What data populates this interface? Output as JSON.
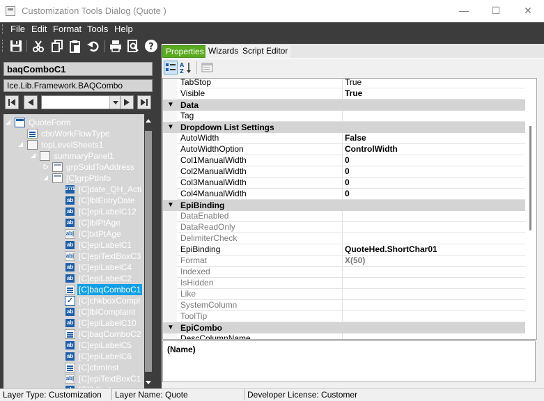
{
  "window": {
    "title": "Customization Tools Dialog  (Quote )",
    "minimize_glyph": "—",
    "maximize_glyph": "☐",
    "close_glyph": "✕"
  },
  "menu": {
    "items": [
      "File",
      "Edit",
      "Format",
      "Tools",
      "Help"
    ]
  },
  "toolbar": {
    "icons": [
      "save-icon",
      "cut-icon",
      "copy-icon",
      "paste-icon",
      "undo-icon",
      "print-icon",
      "print-preview-icon",
      "help-icon"
    ]
  },
  "left": {
    "selected_name": "baqComboC1",
    "selected_type": "Ice.Lib.Framework.BAQCombo",
    "tree": [
      {
        "label": "QuoteForm",
        "icon": "form",
        "indent": 0,
        "expander": "open"
      },
      {
        "label": "cboWorkFlowType",
        "icon": "combo",
        "indent": 1,
        "expander": ""
      },
      {
        "label": "topLevelSheets1",
        "icon": "panel",
        "indent": 1,
        "expander": "open"
      },
      {
        "label": "summaryPanel1",
        "icon": "panel",
        "indent": 2,
        "expander": "open"
      },
      {
        "label": "grpSoldToAddress",
        "icon": "group",
        "indent": 3,
        "expander": "closed"
      },
      {
        "label": "[C]grpPtInfo",
        "icon": "group",
        "indent": 3,
        "expander": "open"
      },
      {
        "label": "[C]date_QH_Acti",
        "icon": "date",
        "indent": 4,
        "expander": ""
      },
      {
        "label": "[C]lblEntryDate",
        "icon": "ab",
        "indent": 4,
        "expander": ""
      },
      {
        "label": "[C]epiLabelC12",
        "icon": "ab",
        "indent": 4,
        "expander": ""
      },
      {
        "label": "[C]lblPtAge",
        "icon": "ab",
        "indent": 4,
        "expander": ""
      },
      {
        "label": "[C]txtPtAge",
        "icon": "txt",
        "indent": 4,
        "expander": ""
      },
      {
        "label": "[C]epiLabelC1",
        "icon": "ab",
        "indent": 4,
        "expander": ""
      },
      {
        "label": "[C]epiTextBoxC3",
        "icon": "txt",
        "indent": 4,
        "expander": ""
      },
      {
        "label": "[C]epiLabelC4",
        "icon": "ab",
        "indent": 4,
        "expander": ""
      },
      {
        "label": "[C]epiLabelC2",
        "icon": "ab",
        "indent": 4,
        "expander": ""
      },
      {
        "label": "[C]baqComboC1",
        "icon": "combo",
        "indent": 4,
        "expander": "",
        "selected": true
      },
      {
        "label": "[C]chkboxCompl",
        "icon": "check",
        "indent": 4,
        "expander": ""
      },
      {
        "label": "[C]lblComplaint",
        "icon": "ab",
        "indent": 4,
        "expander": ""
      },
      {
        "label": "[C]epiLabelC10",
        "icon": "ab",
        "indent": 4,
        "expander": ""
      },
      {
        "label": "[C]baqComboC2",
        "icon": "combo",
        "indent": 4,
        "expander": ""
      },
      {
        "label": "[C]epiLabelC5",
        "icon": "ab",
        "indent": 4,
        "expander": ""
      },
      {
        "label": "[C]epiLabelC6",
        "icon": "ab",
        "indent": 4,
        "expander": ""
      },
      {
        "label": "[C]cbmInst",
        "icon": "combo",
        "indent": 4,
        "expander": ""
      },
      {
        "label": "[C]epiTextBoxC1",
        "icon": "txt",
        "indent": 4,
        "expander": ""
      },
      {
        "label": "[C]lblInst",
        "icon": "ab",
        "indent": 4,
        "expander": ""
      }
    ]
  },
  "tabs": [
    {
      "label": "Properties",
      "active": true
    },
    {
      "label": "Wizards",
      "active": false
    },
    {
      "label": "Script Editor",
      "active": false
    }
  ],
  "grid": {
    "rows": [
      {
        "kind": "prop",
        "name": "TabStop",
        "value": "True",
        "dim": false,
        "bold": false
      },
      {
        "kind": "prop",
        "name": "Visible",
        "value": "True",
        "dim": false,
        "bold": true
      },
      {
        "kind": "cat",
        "name": "Data"
      },
      {
        "kind": "prop",
        "name": "Tag",
        "value": "",
        "dim": false
      },
      {
        "kind": "cat",
        "name": "Dropdown List Settings"
      },
      {
        "kind": "prop",
        "name": "AutoWidth",
        "value": "False",
        "dim": false
      },
      {
        "kind": "prop",
        "name": "AutoWidthOption",
        "value": "ControlWidth",
        "dim": false
      },
      {
        "kind": "prop",
        "name": "Col1ManualWidth",
        "value": "0",
        "dim": false
      },
      {
        "kind": "prop",
        "name": "Col2ManualWidth",
        "value": "0",
        "dim": false
      },
      {
        "kind": "prop",
        "name": "Col3ManualWidth",
        "value": "0",
        "dim": false
      },
      {
        "kind": "prop",
        "name": "Col4ManualWidth",
        "value": "0",
        "dim": false
      },
      {
        "kind": "cat",
        "name": "EpiBinding"
      },
      {
        "kind": "prop",
        "name": "DataEnabled",
        "value": "",
        "dim": true
      },
      {
        "kind": "prop",
        "name": "DataReadOnly",
        "value": "",
        "dim": true
      },
      {
        "kind": "prop",
        "name": "DelimiterCheck",
        "value": "",
        "dim": true
      },
      {
        "kind": "prop",
        "name": "EpiBinding",
        "value": "QuoteHed.ShortChar01",
        "dim": false
      },
      {
        "kind": "prop",
        "name": "Format",
        "value": "X(50)",
        "dim": true
      },
      {
        "kind": "prop",
        "name": "Indexed",
        "value": "",
        "dim": true
      },
      {
        "kind": "prop",
        "name": "IsHidden",
        "value": "",
        "dim": true
      },
      {
        "kind": "prop",
        "name": "Like",
        "value": "",
        "dim": true
      },
      {
        "kind": "prop",
        "name": "SystemColumn",
        "value": "",
        "dim": true
      },
      {
        "kind": "prop",
        "name": "ToolTip",
        "value": "",
        "dim": true
      },
      {
        "kind": "cat",
        "name": "EpiCombo"
      },
      {
        "kind": "prop",
        "name": "DescColumnName",
        "value": "",
        "dim": false
      }
    ]
  },
  "description": {
    "title": "(Name)"
  },
  "status": {
    "layer_type": "Layer Type:  Customization",
    "layer_name": "Layer Name:  Quote",
    "license": "Developer License:  Customer"
  },
  "colors": {
    "accent_tab": "#5aaa1e",
    "selection": "#0ea0e6",
    "dark_bg": "#3c3c3c"
  }
}
